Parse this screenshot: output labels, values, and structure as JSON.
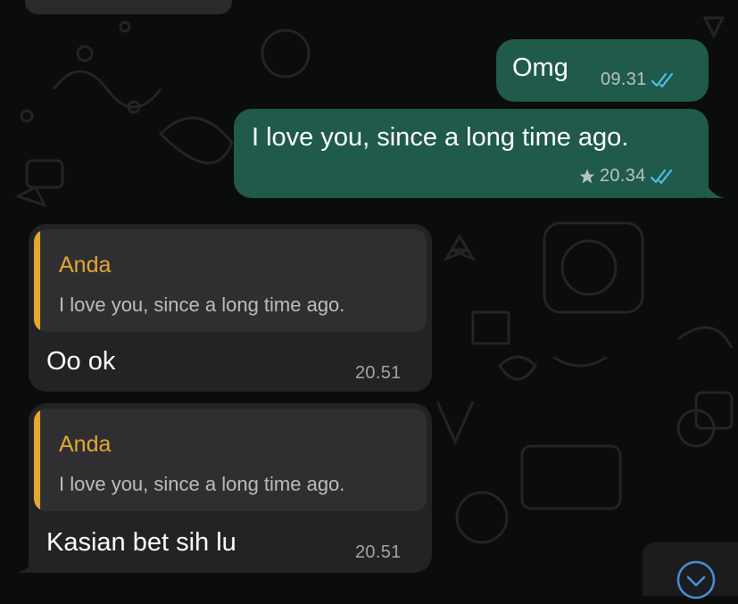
{
  "messages": [
    {
      "direction": "outgoing",
      "text": "Omg",
      "time": "09.31",
      "status": "read-double-tick"
    },
    {
      "direction": "outgoing",
      "text": "I love you, since a long time ago.",
      "time": "20.34",
      "starred": true,
      "status": "read-double-tick"
    },
    {
      "direction": "incoming",
      "quote": {
        "author": "Anda",
        "text": "I love you, since a long time ago."
      },
      "text": "Oo ok",
      "time": "20.51"
    },
    {
      "direction": "incoming",
      "quote": {
        "author": "Anda",
        "text": "I love you, since a long time ago."
      },
      "text": "Kasian bet sih lu",
      "time": "20.51"
    }
  ],
  "colors": {
    "outgoing_bubble": "#1f5a4a",
    "incoming_bubble": "#232325",
    "quote_accent": "#e3a830",
    "read_tick": "#53bdeb"
  },
  "icons": [
    "double-check-icon",
    "star-icon",
    "scroll-down-icon"
  ]
}
